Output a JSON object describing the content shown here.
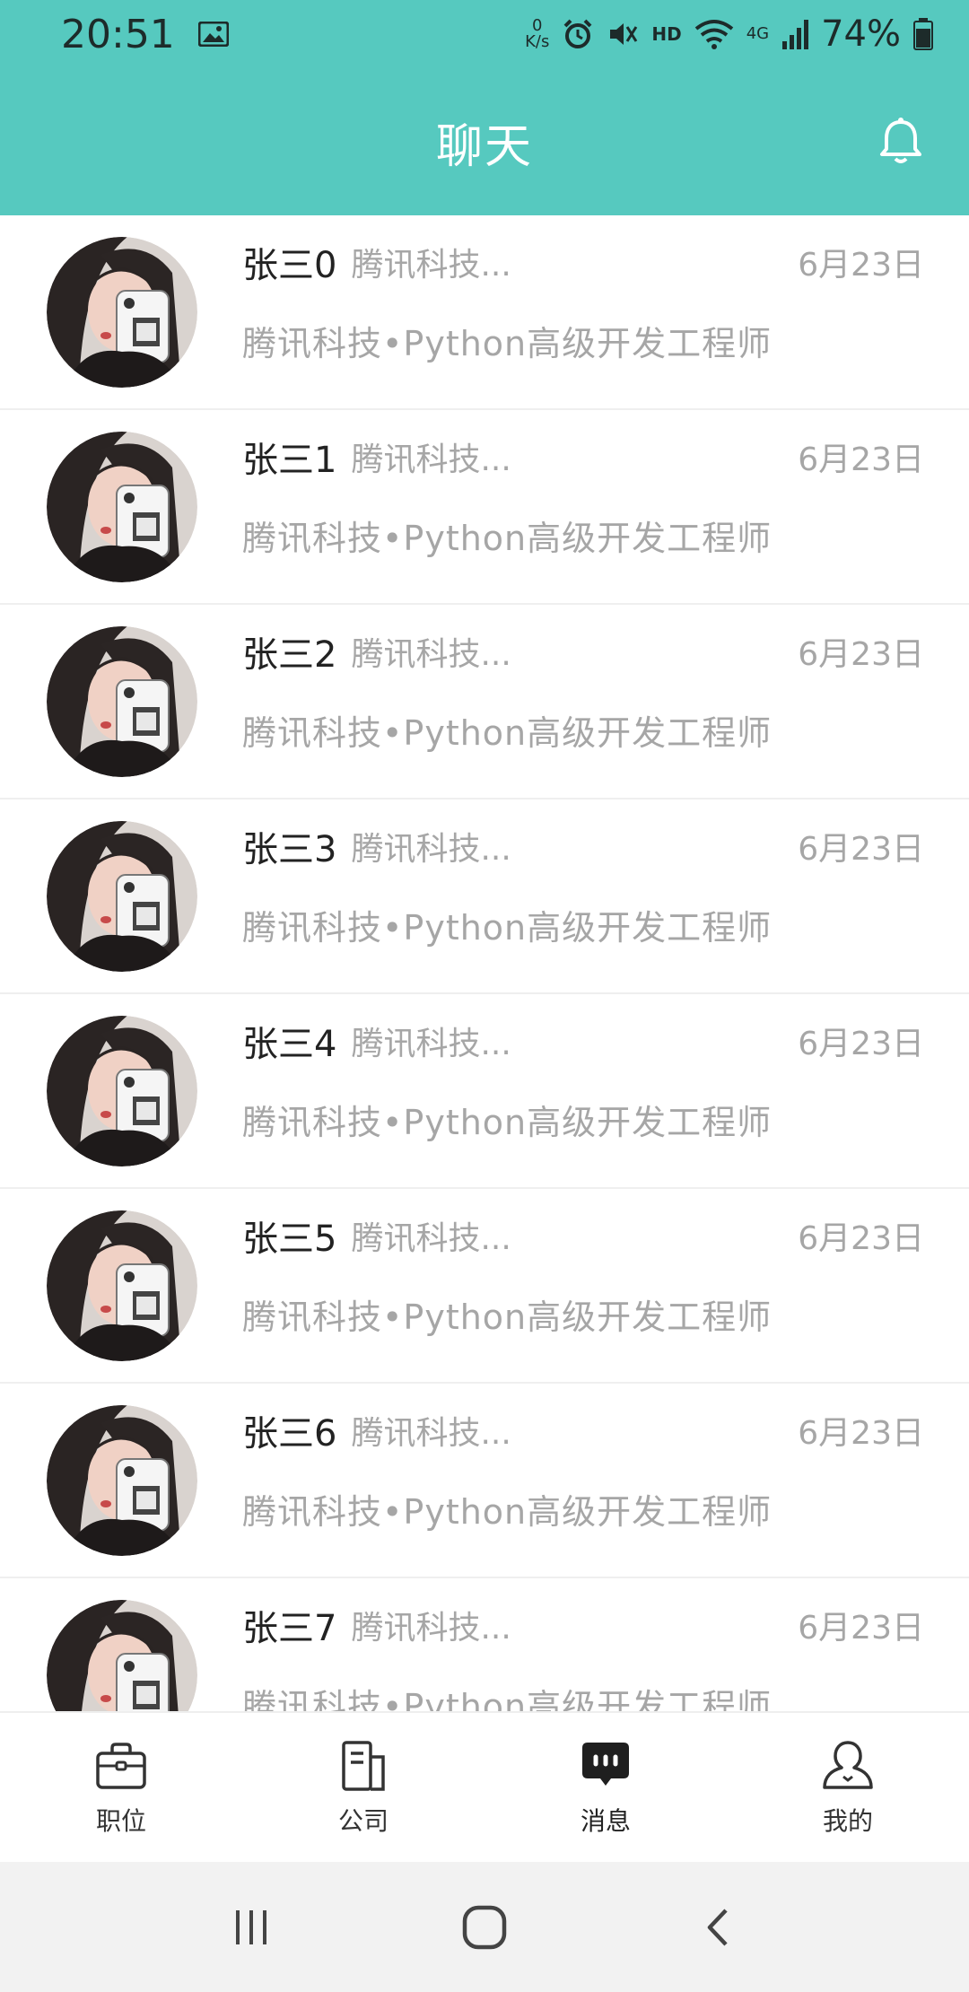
{
  "status_bar": {
    "time": "20:51",
    "net_speed_top": "0",
    "net_speed_bottom": "K/s",
    "hd": "HD",
    "network": "4G",
    "battery": "74%"
  },
  "header": {
    "title": "聊天",
    "bell_icon": "bell-icon"
  },
  "chats": [
    {
      "name": "张三0",
      "company": "腾讯科技...",
      "date": "6月23日",
      "preview": "腾讯科技•Python高级开发工程师"
    },
    {
      "name": "张三1",
      "company": "腾讯科技...",
      "date": "6月23日",
      "preview": "腾讯科技•Python高级开发工程师"
    },
    {
      "name": "张三2",
      "company": "腾讯科技...",
      "date": "6月23日",
      "preview": "腾讯科技•Python高级开发工程师"
    },
    {
      "name": "张三3",
      "company": "腾讯科技...",
      "date": "6月23日",
      "preview": "腾讯科技•Python高级开发工程师"
    },
    {
      "name": "张三4",
      "company": "腾讯科技...",
      "date": "6月23日",
      "preview": "腾讯科技•Python高级开发工程师"
    },
    {
      "name": "张三5",
      "company": "腾讯科技...",
      "date": "6月23日",
      "preview": "腾讯科技•Python高级开发工程师"
    },
    {
      "name": "张三6",
      "company": "腾讯科技...",
      "date": "6月23日",
      "preview": "腾讯科技•Python高级开发工程师"
    },
    {
      "name": "张三7",
      "company": "腾讯科技...",
      "date": "6月23日",
      "preview": "腾讯科技•Python高级开发工程师"
    }
  ],
  "tabbar": {
    "items": [
      {
        "label": "职位",
        "icon": "briefcase-icon"
      },
      {
        "label": "公司",
        "icon": "building-icon"
      },
      {
        "label": "消息",
        "icon": "chat-bubble-icon",
        "active": true
      },
      {
        "label": "我的",
        "icon": "person-icon"
      }
    ]
  },
  "colors": {
    "accent": "#56C9BF",
    "text_primary": "#222222",
    "text_secondary": "#a6a6a6"
  }
}
